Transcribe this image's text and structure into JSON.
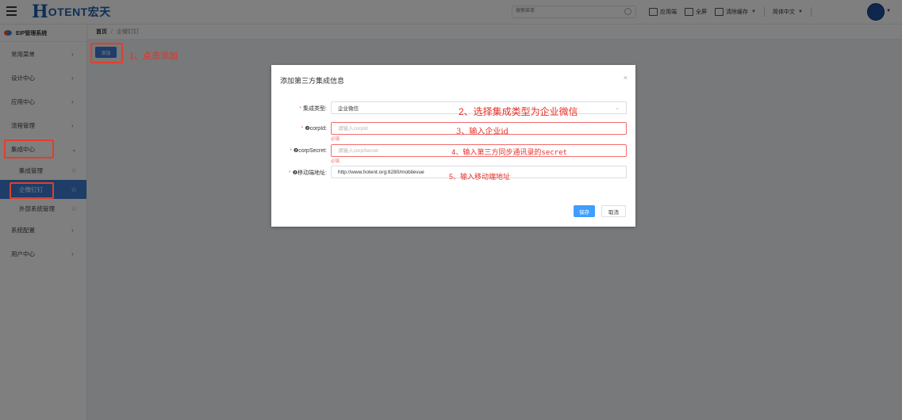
{
  "header": {
    "logo_mark": "H",
    "logo_text": "OTENT宏天",
    "search_placeholder": "搜索菜单",
    "tools": [
      {
        "label": "应用端",
        "icon": "monitor-icon"
      },
      {
        "label": "全屏",
        "icon": "fullscreen-icon"
      },
      {
        "label": "清除缓存",
        "icon": "trash-icon"
      }
    ],
    "language": "简体中文"
  },
  "sidebar": {
    "title": "EIP管理系统",
    "items": [
      {
        "label": "常用菜单"
      },
      {
        "label": "设计中心"
      },
      {
        "label": "应用中心"
      },
      {
        "label": "流程管理"
      },
      {
        "label": "集成中心"
      },
      {
        "label": "集成管理"
      },
      {
        "label": "企微钉钉"
      },
      {
        "label": "外部系统管理"
      },
      {
        "label": "系统配置"
      },
      {
        "label": "用户中心"
      }
    ]
  },
  "breadcrumb": {
    "home": "首页",
    "separator": "/",
    "current": "企微钉钉"
  },
  "main": {
    "add_button": "添加"
  },
  "annotations": {
    "a1": "1、点击添加",
    "a2": "2、选择集成类型为企业微信",
    "a3": "3、输入企业id",
    "a4": "4、输入第三方同步通讯录的secret",
    "a5": "5、输入移动端地址"
  },
  "dialog": {
    "title": "添加第三方集成信息",
    "close": "×",
    "fields": {
      "type": {
        "label": "集成类型:",
        "value": "企业微信"
      },
      "corpid": {
        "label": "❷corpId:",
        "placeholder": "请输入corpId",
        "error": "必填"
      },
      "secret": {
        "label": "❷corpSecret:",
        "placeholder": "请输入corpSecret",
        "error": "必填"
      },
      "mobile": {
        "label": "❷移动端地址:",
        "value": "http://www.hotent.org:8280/mobilevue"
      }
    },
    "save": "保存",
    "cancel": "取消"
  },
  "colors": {
    "primary": "#3d7bd0",
    "annotation": "#e52f28",
    "error": "#f56c6c"
  }
}
